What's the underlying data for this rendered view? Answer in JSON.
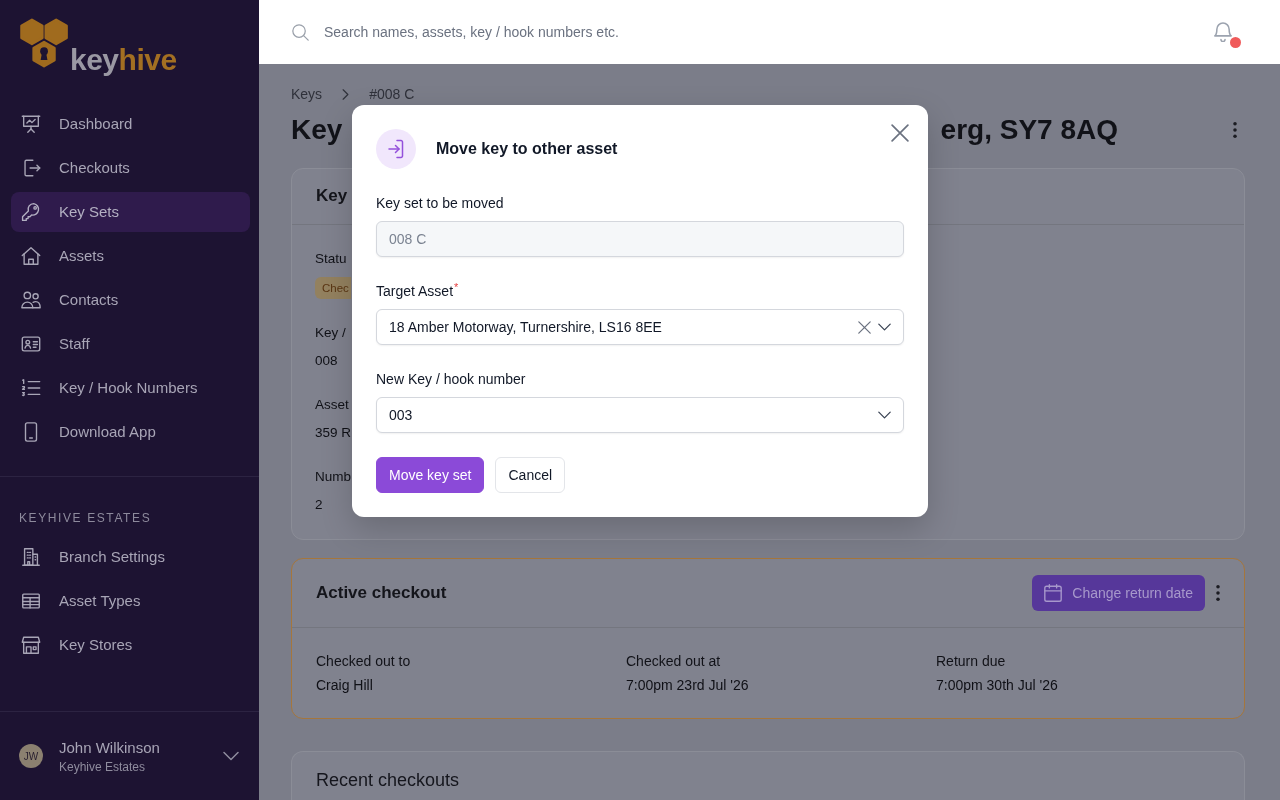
{
  "sidebar": {
    "logo": {
      "lead": "key",
      "accent": "hive"
    },
    "nav": [
      {
        "label": "Dashboard",
        "selected": false
      },
      {
        "label": "Checkouts",
        "selected": false
      },
      {
        "label": "Key Sets",
        "selected": true
      },
      {
        "label": "Assets",
        "selected": false
      },
      {
        "label": "Contacts",
        "selected": false
      },
      {
        "label": "Staff",
        "selected": false
      },
      {
        "label": "Key / Hook Numbers",
        "selected": false
      },
      {
        "label": "Download App",
        "selected": false
      }
    ],
    "section": {
      "title": "KEYHIVE ESTATES",
      "items": [
        {
          "label": "Branch Settings",
          "selected": false
        },
        {
          "label": "Asset Types",
          "selected": false
        },
        {
          "label": "Key Stores",
          "selected": false
        }
      ]
    },
    "user": {
      "initials": "JW",
      "name": "John Wilkinson",
      "organisation": "Keyhive Estates"
    }
  },
  "topbar": {
    "search": {
      "placeholder": "Search names, assets, key / hook numbers etc."
    },
    "notifications": {
      "unread": true
    }
  },
  "page": {
    "breadcrumb": [
      {
        "label": "Keys"
      },
      {
        "label": "#008 C"
      }
    ],
    "title": {
      "visible_start": "Key",
      "visible_end": "erg, SY7 8AQ"
    },
    "key_set_card": {
      "title": "Key",
      "fields": [
        {
          "label": "Statu",
          "kind": "badge",
          "value": "Chec"
        },
        {
          "label": "Key /",
          "kind": "text",
          "value": "008"
        },
        {
          "label": "Asset",
          "kind": "text",
          "value": "359 R"
        },
        {
          "label": "Numb",
          "kind": "text",
          "value": "2"
        }
      ]
    },
    "active_checkout": {
      "title": "Active checkout",
      "action": "Change return date",
      "fields": [
        {
          "label": "Checked out to",
          "value": "Craig Hill"
        },
        {
          "label": "Checked out at",
          "value": "7:00pm 23rd Jul '26"
        },
        {
          "label": "Return due",
          "value": "7:00pm 30th Jul '26"
        }
      ]
    },
    "recent_checkouts": {
      "title": "Recent checkouts"
    }
  },
  "modal": {
    "title": "Move key to other asset",
    "fields": [
      {
        "label": "Key set to be moved",
        "kind": "text",
        "value": "008 C",
        "disabled": true
      },
      {
        "label": "Target Asset",
        "required_mark": "*",
        "kind": "select",
        "value": "18 Amber Motorway, Turnershire, LS16 8EE",
        "disabled": false,
        "clearable": true
      },
      {
        "label": "New Key / hook number",
        "kind": "select",
        "value": "003",
        "disabled": false,
        "clearable": false
      }
    ],
    "actions": [
      {
        "label": "Move key set",
        "kind": "primary"
      },
      {
        "label": "Cancel",
        "kind": "secondary"
      }
    ]
  }
}
